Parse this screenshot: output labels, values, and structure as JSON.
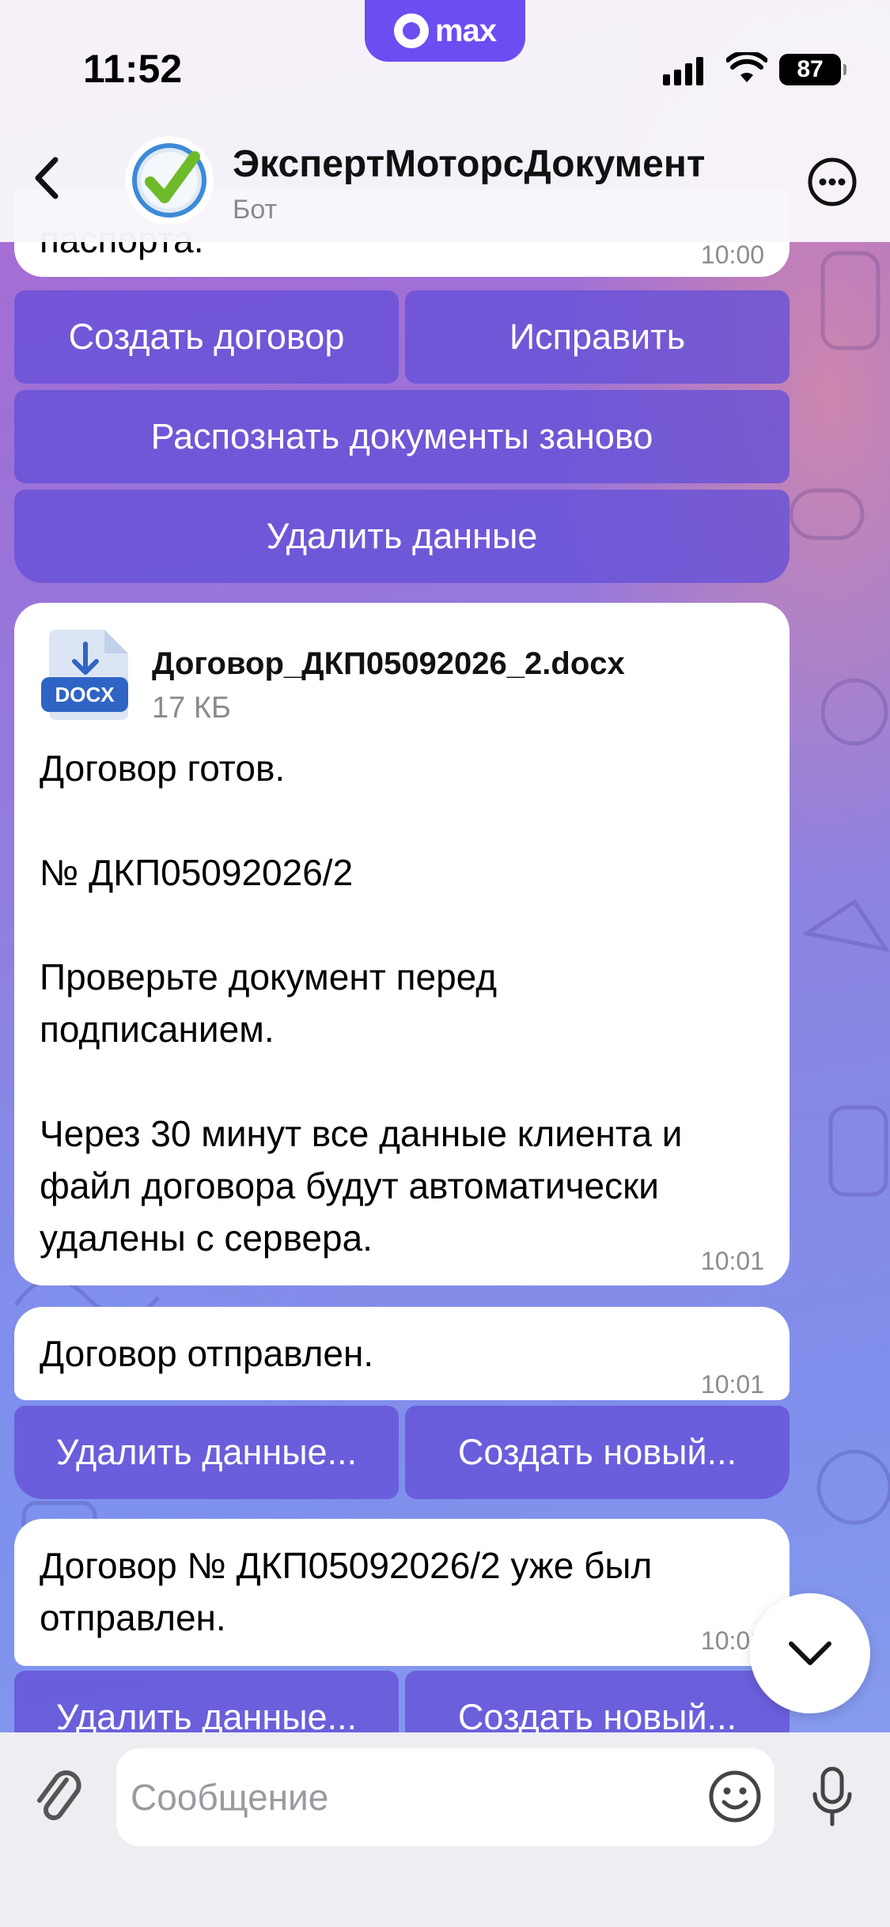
{
  "status_bar": {
    "time": "11:52",
    "battery": "87",
    "app_pill_label": "max"
  },
  "header": {
    "title": "ЭкспертМоторсДокумент",
    "subtitle": "Бот"
  },
  "messages": {
    "top_partial": {
      "text": "паспорта.",
      "time": "10:00"
    },
    "keyboard1": {
      "create_contract": "Создать договор",
      "fix": "Исправить",
      "recognize_again": "Распознать документы заново",
      "delete_data": "Удалить данные"
    },
    "file_message": {
      "file_name": "Договор_ДКП05092026_2.docx",
      "file_size": "17 КБ",
      "file_ext": "DOCX",
      "line1": "Договор готов.",
      "line2": "№ ДКП05092026/2",
      "line3a": "Проверьте документ перед",
      "line3b": "подписанием.",
      "line4a": "Через 30 минут все данные клиента и",
      "line4b": "файл договора будут автоматически",
      "line4c": "удалены с сервера.",
      "time": "10:01"
    },
    "sent_message": {
      "text": "Договор отправлен.",
      "time": "10:01"
    },
    "keyboard2": {
      "delete_data": "Удалить данные...",
      "create_new": "Создать новый..."
    },
    "already_sent_message": {
      "line1": "Договор № ДКП05092026/2 уже был",
      "line2": "отправлен.",
      "time": "10:01"
    },
    "keyboard3": {
      "delete_data": "Удалить данные...",
      "create_new": "Создать новый..."
    }
  },
  "composer": {
    "placeholder": "Сообщение"
  },
  "colors": {
    "accent": "#6c4df2",
    "keyboard_button": "#6450d7"
  }
}
